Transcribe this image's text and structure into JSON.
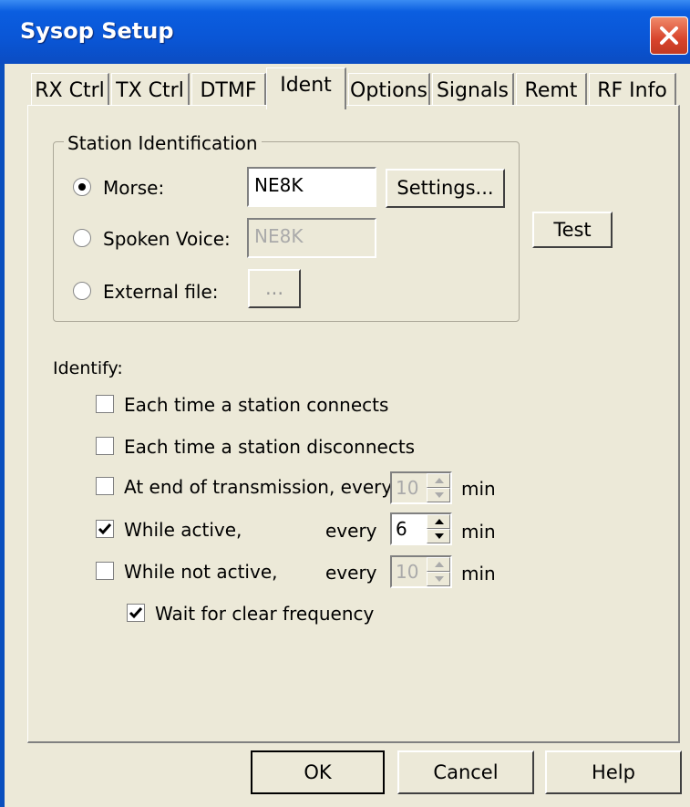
{
  "window": {
    "title": "Sysop Setup"
  },
  "tabs": [
    {
      "label": "RX Ctrl"
    },
    {
      "label": "TX Ctrl"
    },
    {
      "label": "DTMF"
    },
    {
      "label": "Ident"
    },
    {
      "label": "Options"
    },
    {
      "label": "Signals"
    },
    {
      "label": "Remt"
    },
    {
      "label": "RF Info"
    }
  ],
  "active_tab": "Ident",
  "station_id": {
    "group_title": "Station Identification",
    "morse": {
      "label": "Morse:",
      "value": "NE8K",
      "selected": true,
      "settings_button": "Settings..."
    },
    "voice": {
      "label": "Spoken Voice:",
      "value": "NE8K",
      "selected": false
    },
    "external": {
      "label": "External file:",
      "browse_button": "...",
      "selected": false
    }
  },
  "test_button": "Test",
  "identify": {
    "heading": "Identify:",
    "each_connect": {
      "label": "Each time a station connects",
      "checked": false
    },
    "each_disconnect": {
      "label": "Each time a station disconnects",
      "checked": false
    },
    "end_tx": {
      "label": "At end of transmission, every",
      "checked": false,
      "value": "10",
      "unit": "min"
    },
    "while_active": {
      "label": "While active,",
      "every": "every",
      "checked": true,
      "value": "6",
      "unit": "min"
    },
    "while_not_active": {
      "label": "While not active,",
      "every": "every",
      "checked": false,
      "value": "10",
      "unit": "min"
    },
    "wait_clear": {
      "label": "Wait for clear frequency",
      "checked": true
    }
  },
  "footer": {
    "ok": "OK",
    "cancel": "Cancel",
    "help": "Help"
  }
}
